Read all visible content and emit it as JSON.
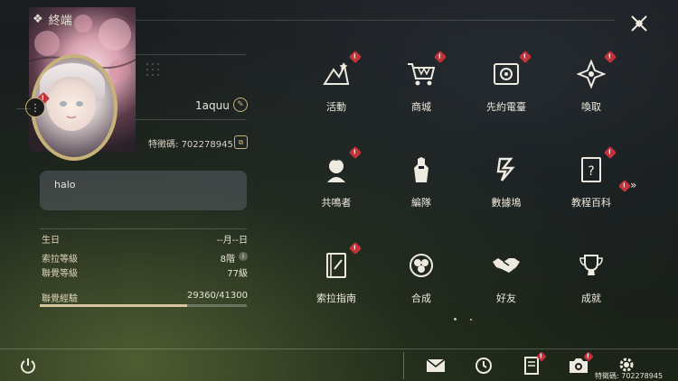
{
  "header": {
    "title": "終端"
  },
  "profile": {
    "username": "1aquu",
    "uid_label": "特徵碼:",
    "uid": "702278945",
    "signature": "halo"
  },
  "stats": {
    "birthday_label": "生日",
    "birthday_value": "--月--日",
    "sola_level_label": "索拉等級",
    "sola_level_value": "8階",
    "union_level_label": "聯覺等級",
    "union_level_value": "77級",
    "union_exp_label": "聯覺經驗",
    "union_exp_value": "29360/41300",
    "union_exp_fraction": 0.711
  },
  "menu": [
    {
      "label": "活動",
      "icon": "activity-icon",
      "badge": "!"
    },
    {
      "label": "商城",
      "icon": "shop-cart-icon",
      "badge": "!"
    },
    {
      "label": "先約電臺",
      "icon": "radio-icon",
      "badge": "!"
    },
    {
      "label": "喚取",
      "icon": "convene-star-icon",
      "badge": "!"
    },
    {
      "label": "共鳴者",
      "icon": "resonator-icon",
      "badge": "!"
    },
    {
      "label": "編隊",
      "icon": "team-icon",
      "badge": ""
    },
    {
      "label": "數據塢",
      "icon": "data-bank-icon",
      "badge": ""
    },
    {
      "label": "教程百科",
      "icon": "tutorial-book-icon",
      "badge": "!"
    },
    {
      "label": "索拉指南",
      "icon": "guidebook-icon",
      "badge": "!"
    },
    {
      "label": "合成",
      "icon": "synthesis-icon",
      "badge": ""
    },
    {
      "label": "好友",
      "icon": "handshake-icon",
      "badge": ""
    },
    {
      "label": "成就",
      "icon": "trophy-icon",
      "badge": ""
    }
  ],
  "footer": {
    "uid_text": "特徵碼: 702278945",
    "icons": [
      "power-icon",
      "mail-icon",
      "clock-icon",
      "notice-icon",
      "camera-icon",
      "settings-gear-icon"
    ]
  },
  "colors": {
    "accent_gold": "#c7b27a",
    "badge_red": "#c4323a"
  }
}
